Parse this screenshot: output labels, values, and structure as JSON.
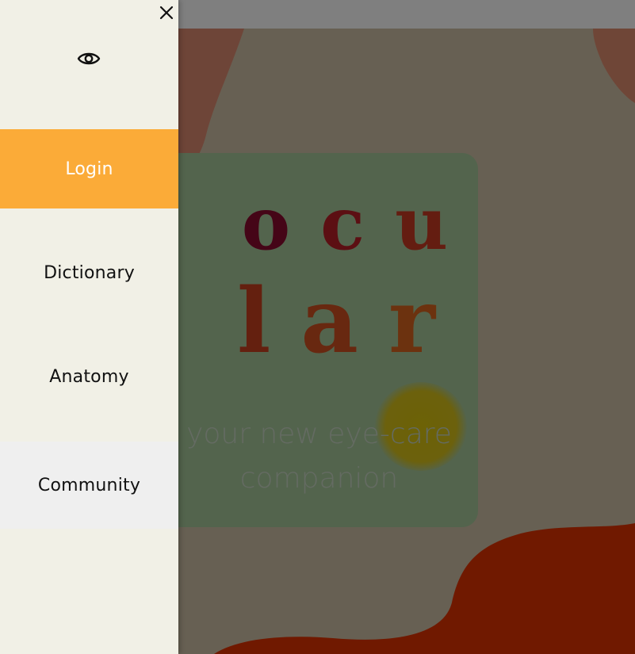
{
  "drawer": {
    "close_icon": "close-icon",
    "logo_icon": "eye-icon",
    "items": [
      {
        "label": "Login",
        "active": true
      },
      {
        "label": "Dictionary"
      },
      {
        "label": "Anatomy"
      },
      {
        "label": "Community",
        "hovered": true
      }
    ]
  },
  "hero": {
    "brand_row1": [
      "o",
      "c",
      "u"
    ],
    "brand_row2": [
      "l",
      "a",
      "r"
    ],
    "tagline_line1": "your new eye-care",
    "tagline_line2": "companion"
  },
  "colors": {
    "accent": "#fbab38",
    "drawer_bg": "#f1f0e6",
    "hover_bg": "#efefef",
    "hero_card": "#a7c89b",
    "blob_dark": "#e07a60",
    "blob_red": "#e03300",
    "page_bg": "#cfc0a6",
    "brand_gradient_start": "#8a0a2e",
    "brand_gradient_end": "#d8641e"
  }
}
